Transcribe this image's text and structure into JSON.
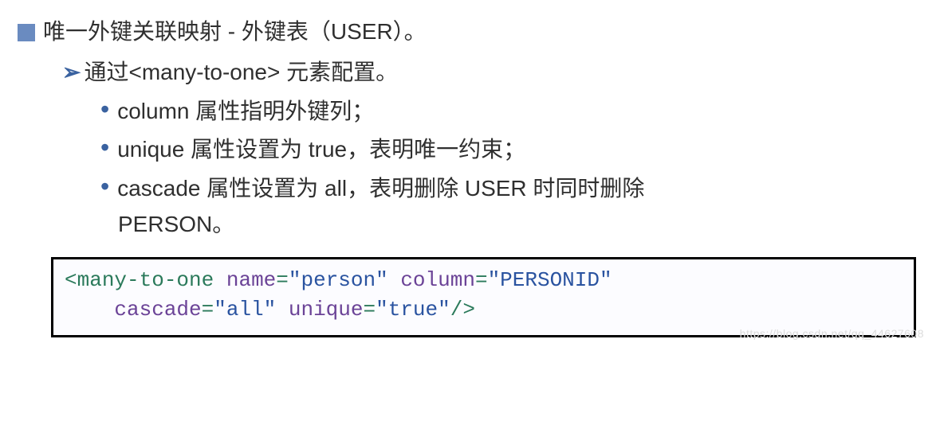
{
  "heading": "唯一外键关联映射 - 外键表（USER）。",
  "sub": "通过<many-to-one> 元素配置。",
  "bullets": [
    "column 属性指明外键列；",
    "unique 属性设置为 true，表明唯一约束；",
    "cascade 属性设置为 all，表明删除 USER 时同时删除"
  ],
  "bullet3_cont": "PERSON。",
  "code": {
    "open_bracket": "<",
    "tag": "many-to-one",
    "attr_name1": "name",
    "val1": "\"person\"",
    "attr_name2": "column",
    "val2": "\"PERSONID\"",
    "attr_name3": "cascade",
    "val3": "\"all\"",
    "attr_name4": "unique",
    "val4": "\"true\"",
    "eq": "=",
    "close": "/>"
  },
  "watermark": "https://blog.csdn.net/qq_44627608"
}
